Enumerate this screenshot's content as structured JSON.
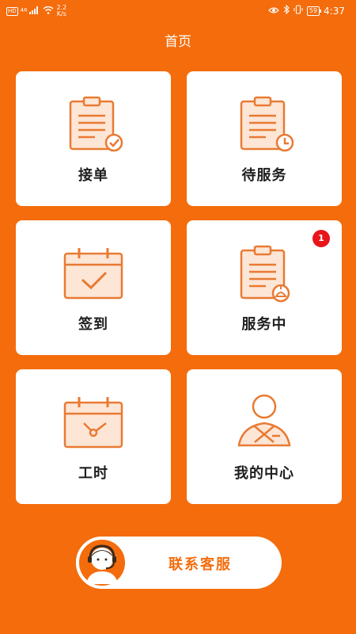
{
  "status_bar": {
    "hd_badge": "HD",
    "net_type": "⁴⁶",
    "speed_value": "2.2",
    "speed_unit": "K/s",
    "battery": "59",
    "time": "4:37"
  },
  "header": {
    "title": "首页"
  },
  "menu": {
    "items": [
      {
        "label": "接单",
        "icon": "clipboard-check-icon"
      },
      {
        "label": "待服务",
        "icon": "clipboard-clock-icon"
      },
      {
        "label": "签到",
        "icon": "calendar-check-icon"
      },
      {
        "label": "服务中",
        "icon": "clipboard-bell-icon",
        "badge": "1"
      },
      {
        "label": "工时",
        "icon": "calendar-clock-icon"
      },
      {
        "label": "我的中心",
        "icon": "user-profile-icon"
      }
    ]
  },
  "service": {
    "label": "联系客服",
    "icon": "customer-service-agent-icon"
  },
  "colors": {
    "accent": "#f46c0c",
    "badge": "#e8151b",
    "card": "#ffffff"
  }
}
